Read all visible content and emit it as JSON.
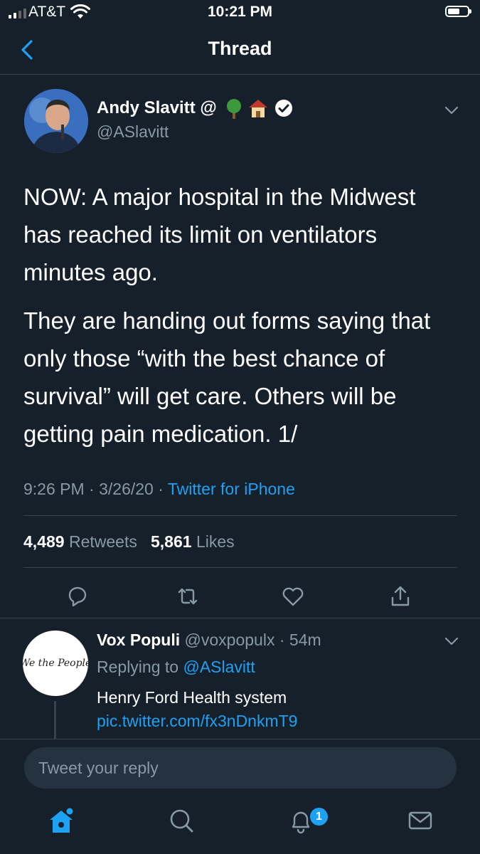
{
  "status_bar": {
    "carrier": "AT&T",
    "time": "10:21 PM",
    "battery_level": 0.6
  },
  "nav": {
    "title": "Thread",
    "back_icon": "chevron-left-icon"
  },
  "tweet": {
    "author_name": "Andy Slavitt @",
    "badges": [
      "tree-emoji",
      "house-emoji",
      "verified-icon"
    ],
    "handle": "@ASlavitt",
    "paragraphs": [
      "NOW: A major hospital in the Midwest has reached its limit on ventilators minutes ago.",
      "They are handing out forms saying that only those “with the best chance of survival” will get care. Others will be getting pain medication. 1/"
    ],
    "time": "9:26 PM",
    "date": "3/26/20",
    "source": "Twitter for iPhone",
    "retweets_count": "4,489",
    "retweets_label": "Retweets",
    "likes_count": "5,861",
    "likes_label": "Likes",
    "actions": [
      "reply-icon",
      "retweet-icon",
      "like-icon",
      "share-icon"
    ]
  },
  "reply": {
    "author_name": "Vox Populi",
    "handle": "@voxpopulx",
    "time": "54m",
    "replying_label": "Replying to",
    "replying_to": "@ASlavitt",
    "avatar_text": "We the People",
    "text": "Henry Ford Health system",
    "link": "pic.twitter.com/fx3nDnkmT9"
  },
  "composer": {
    "placeholder": "Tweet your reply"
  },
  "tabbar": {
    "items": [
      "home-icon",
      "search-icon",
      "notifications-icon",
      "messages-icon"
    ],
    "notification_count": "1"
  },
  "colors": {
    "background": "#15202b",
    "accent": "#1da1f2",
    "muted": "#8899a6",
    "divider": "#38444d"
  }
}
